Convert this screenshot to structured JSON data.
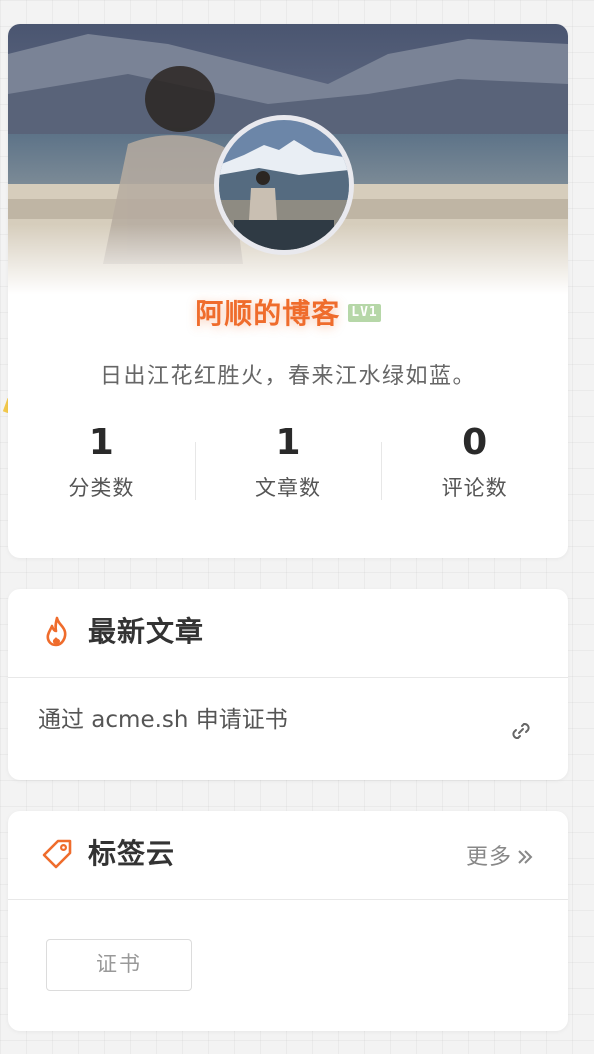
{
  "profile": {
    "blog_name": "阿顺的博客",
    "level_badge": "LV1",
    "motto": "日出江花红胜火，春来江水绿如蓝。",
    "stats": [
      {
        "value": "1",
        "label": "分类数"
      },
      {
        "value": "1",
        "label": "文章数"
      },
      {
        "value": "0",
        "label": "评论数"
      }
    ]
  },
  "recent_posts": {
    "title": "最新文章",
    "items": [
      {
        "title": "通过 acme.sh 申请证书"
      }
    ]
  },
  "tag_cloud": {
    "title": "标签云",
    "more_label": "更多",
    "tags": [
      "证书"
    ]
  },
  "colors": {
    "accent": "#ef6c2c",
    "background": "#f3f3f3",
    "card": "#ffffff",
    "level_badge": "#b6d7a8"
  },
  "icons": {
    "recent": "fire-icon",
    "tags": "tag-icon",
    "article_link": "link-icon",
    "more": "double-chevron-right-icon"
  }
}
